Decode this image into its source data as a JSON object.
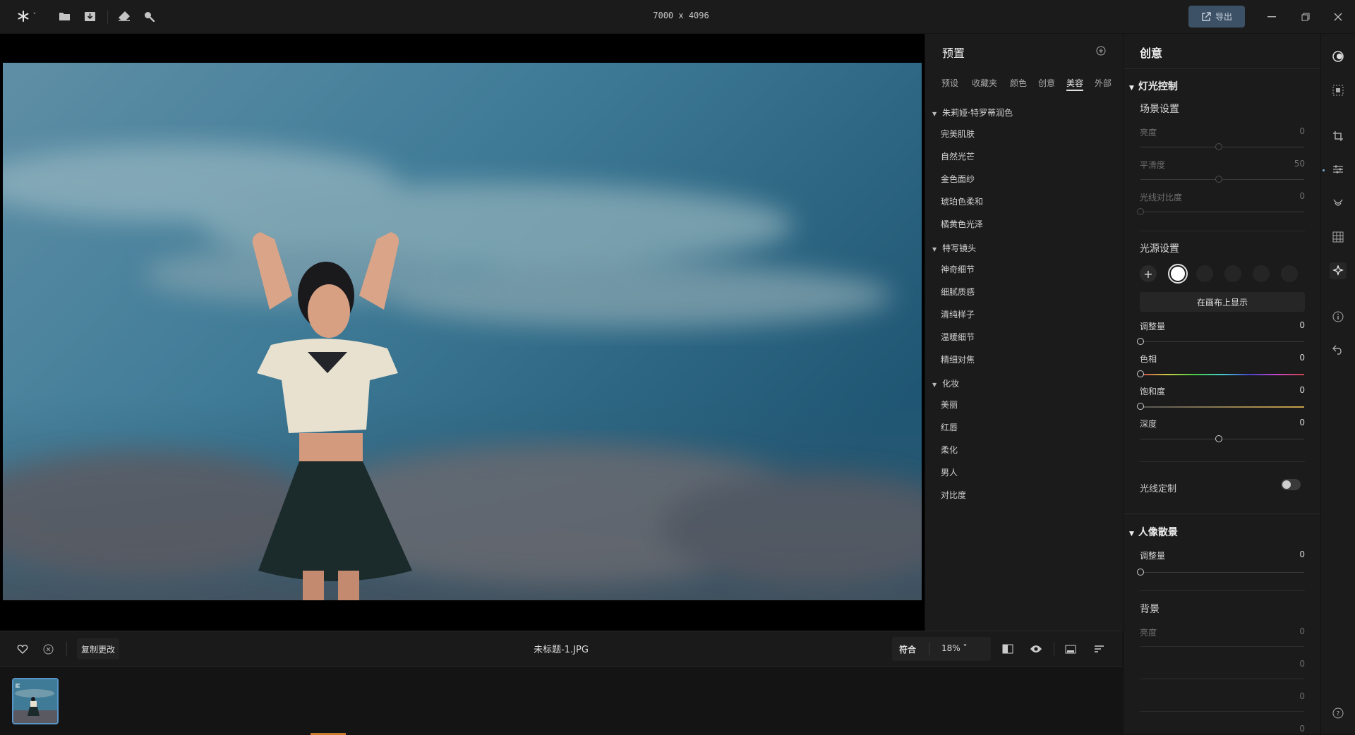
{
  "toolbar": {
    "dimensions": "7000 x 4096",
    "export_label": "导出",
    "icons": [
      "app-logo-icon",
      "chevron-down-icon",
      "folder-icon",
      "import-icon",
      "eraser-icon",
      "search-zoom-icon",
      "minimize-icon",
      "maximize-icon",
      "close-icon"
    ]
  },
  "preset_panel": {
    "title": "预置",
    "tabs": [
      "预设",
      "收藏夹",
      "颜色",
      "创意",
      "美容",
      "外部"
    ],
    "active_tab": "美容",
    "groups": [
      {
        "name": "朱莉娅·特罗蒂润色",
        "items": [
          "完美肌肤",
          "自然光芒",
          "金色面纱",
          "琥珀色柔和",
          "橘黄色光泽"
        ]
      },
      {
        "name": "特写镜头",
        "items": [
          "神奇细节",
          "细腻质感",
          "清纯样子",
          "温暖细节",
          "精细对焦"
        ]
      },
      {
        "name": "化妆",
        "items": [
          "美丽",
          "红唇",
          "柔化",
          "男人",
          "对比度"
        ]
      }
    ]
  },
  "creative_panel": {
    "title": "创意",
    "light_control": {
      "header": "灯光控制",
      "scene_header": "场景设置",
      "scene_sliders": [
        {
          "label": "亮度",
          "value": "0",
          "pos": 0.5
        },
        {
          "label": "平滑度",
          "value": "50",
          "pos": 0.5
        },
        {
          "label": "光线对比度",
          "value": "0",
          "pos": 0.0
        }
      ],
      "source_header": "光源设置",
      "show_on_canvas": "在画布上显示",
      "source_sliders": [
        {
          "label": "调整量",
          "value": "0",
          "pos": 0.0
        },
        {
          "label": "色相",
          "value": "0",
          "pos": 0.0
        },
        {
          "label": "饱和度",
          "value": "0",
          "pos": 0.0
        },
        {
          "label": "深度",
          "value": "0",
          "pos": 0.5
        }
      ],
      "custom_light": "光线定制",
      "custom_light_on": false
    },
    "portrait_bokeh": {
      "header": "人像散景",
      "amount_label": "调整量",
      "amount_value": "0",
      "background_header": "背景",
      "bg_sliders": [
        {
          "label": "亮度",
          "value": "0"
        },
        {
          "label": "",
          "value": "0"
        },
        {
          "label": "",
          "value": "0"
        },
        {
          "label": "",
          "value": "0"
        }
      ]
    }
  },
  "bottom_bar": {
    "copy_changes": "复制更改",
    "filename": "未标题-1.JPG",
    "fit_label": "符合",
    "zoom_label": "18% ˅"
  },
  "colors": {
    "accent": "#3d5166",
    "tab_underline": "#e0e0e0",
    "panel_bg": "#1b1b1b"
  }
}
